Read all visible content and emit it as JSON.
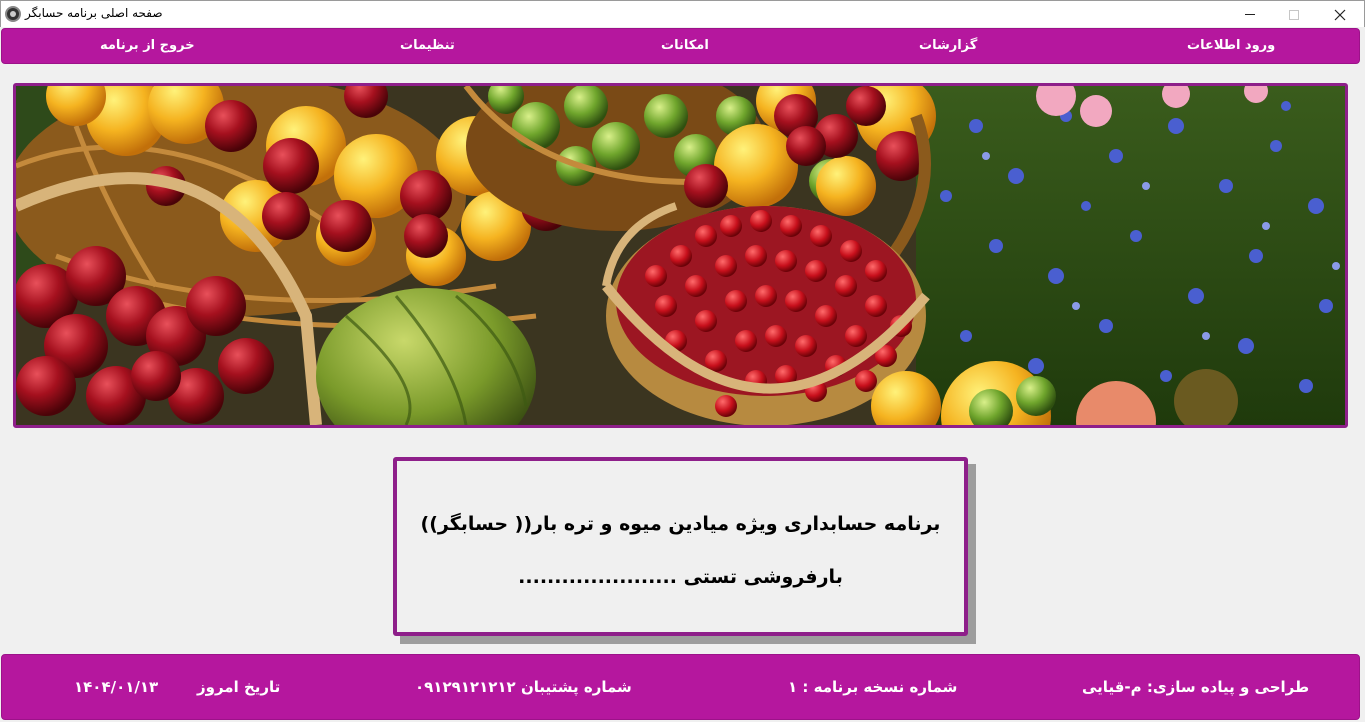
{
  "window": {
    "title": "صفحه اصلی برنامه حسابگر",
    "controls": {
      "minimize": "minimize-icon",
      "maximize": "maximize-icon",
      "close": "close-icon"
    }
  },
  "menu": {
    "items": [
      {
        "label": "ورود اطلاعات"
      },
      {
        "label": "گزارشات"
      },
      {
        "label": "امکانات"
      },
      {
        "label": "تنظیمات"
      },
      {
        "label": "خروج از برنامه"
      }
    ]
  },
  "info": {
    "line1": "برنامه حسابداری ویژه میادین میوه و تره بار(( حسابگر))",
    "line2": "بارفروشی تستی ......................"
  },
  "footer": {
    "designer": "طراحی و پیاده سازی: م-قیایی",
    "version": "شماره نسخه برنامه : ۱",
    "support": "شماره پشتیبان ۰۹۱۲۹۱۲۱۲۱۲",
    "date_label": "تاریخ امروز",
    "date_value": "۱۴۰۴/۰۱/۱۳"
  },
  "colors": {
    "accent": "#b5179e",
    "border": "#8e1f8a",
    "background": "#f0f0f0"
  }
}
